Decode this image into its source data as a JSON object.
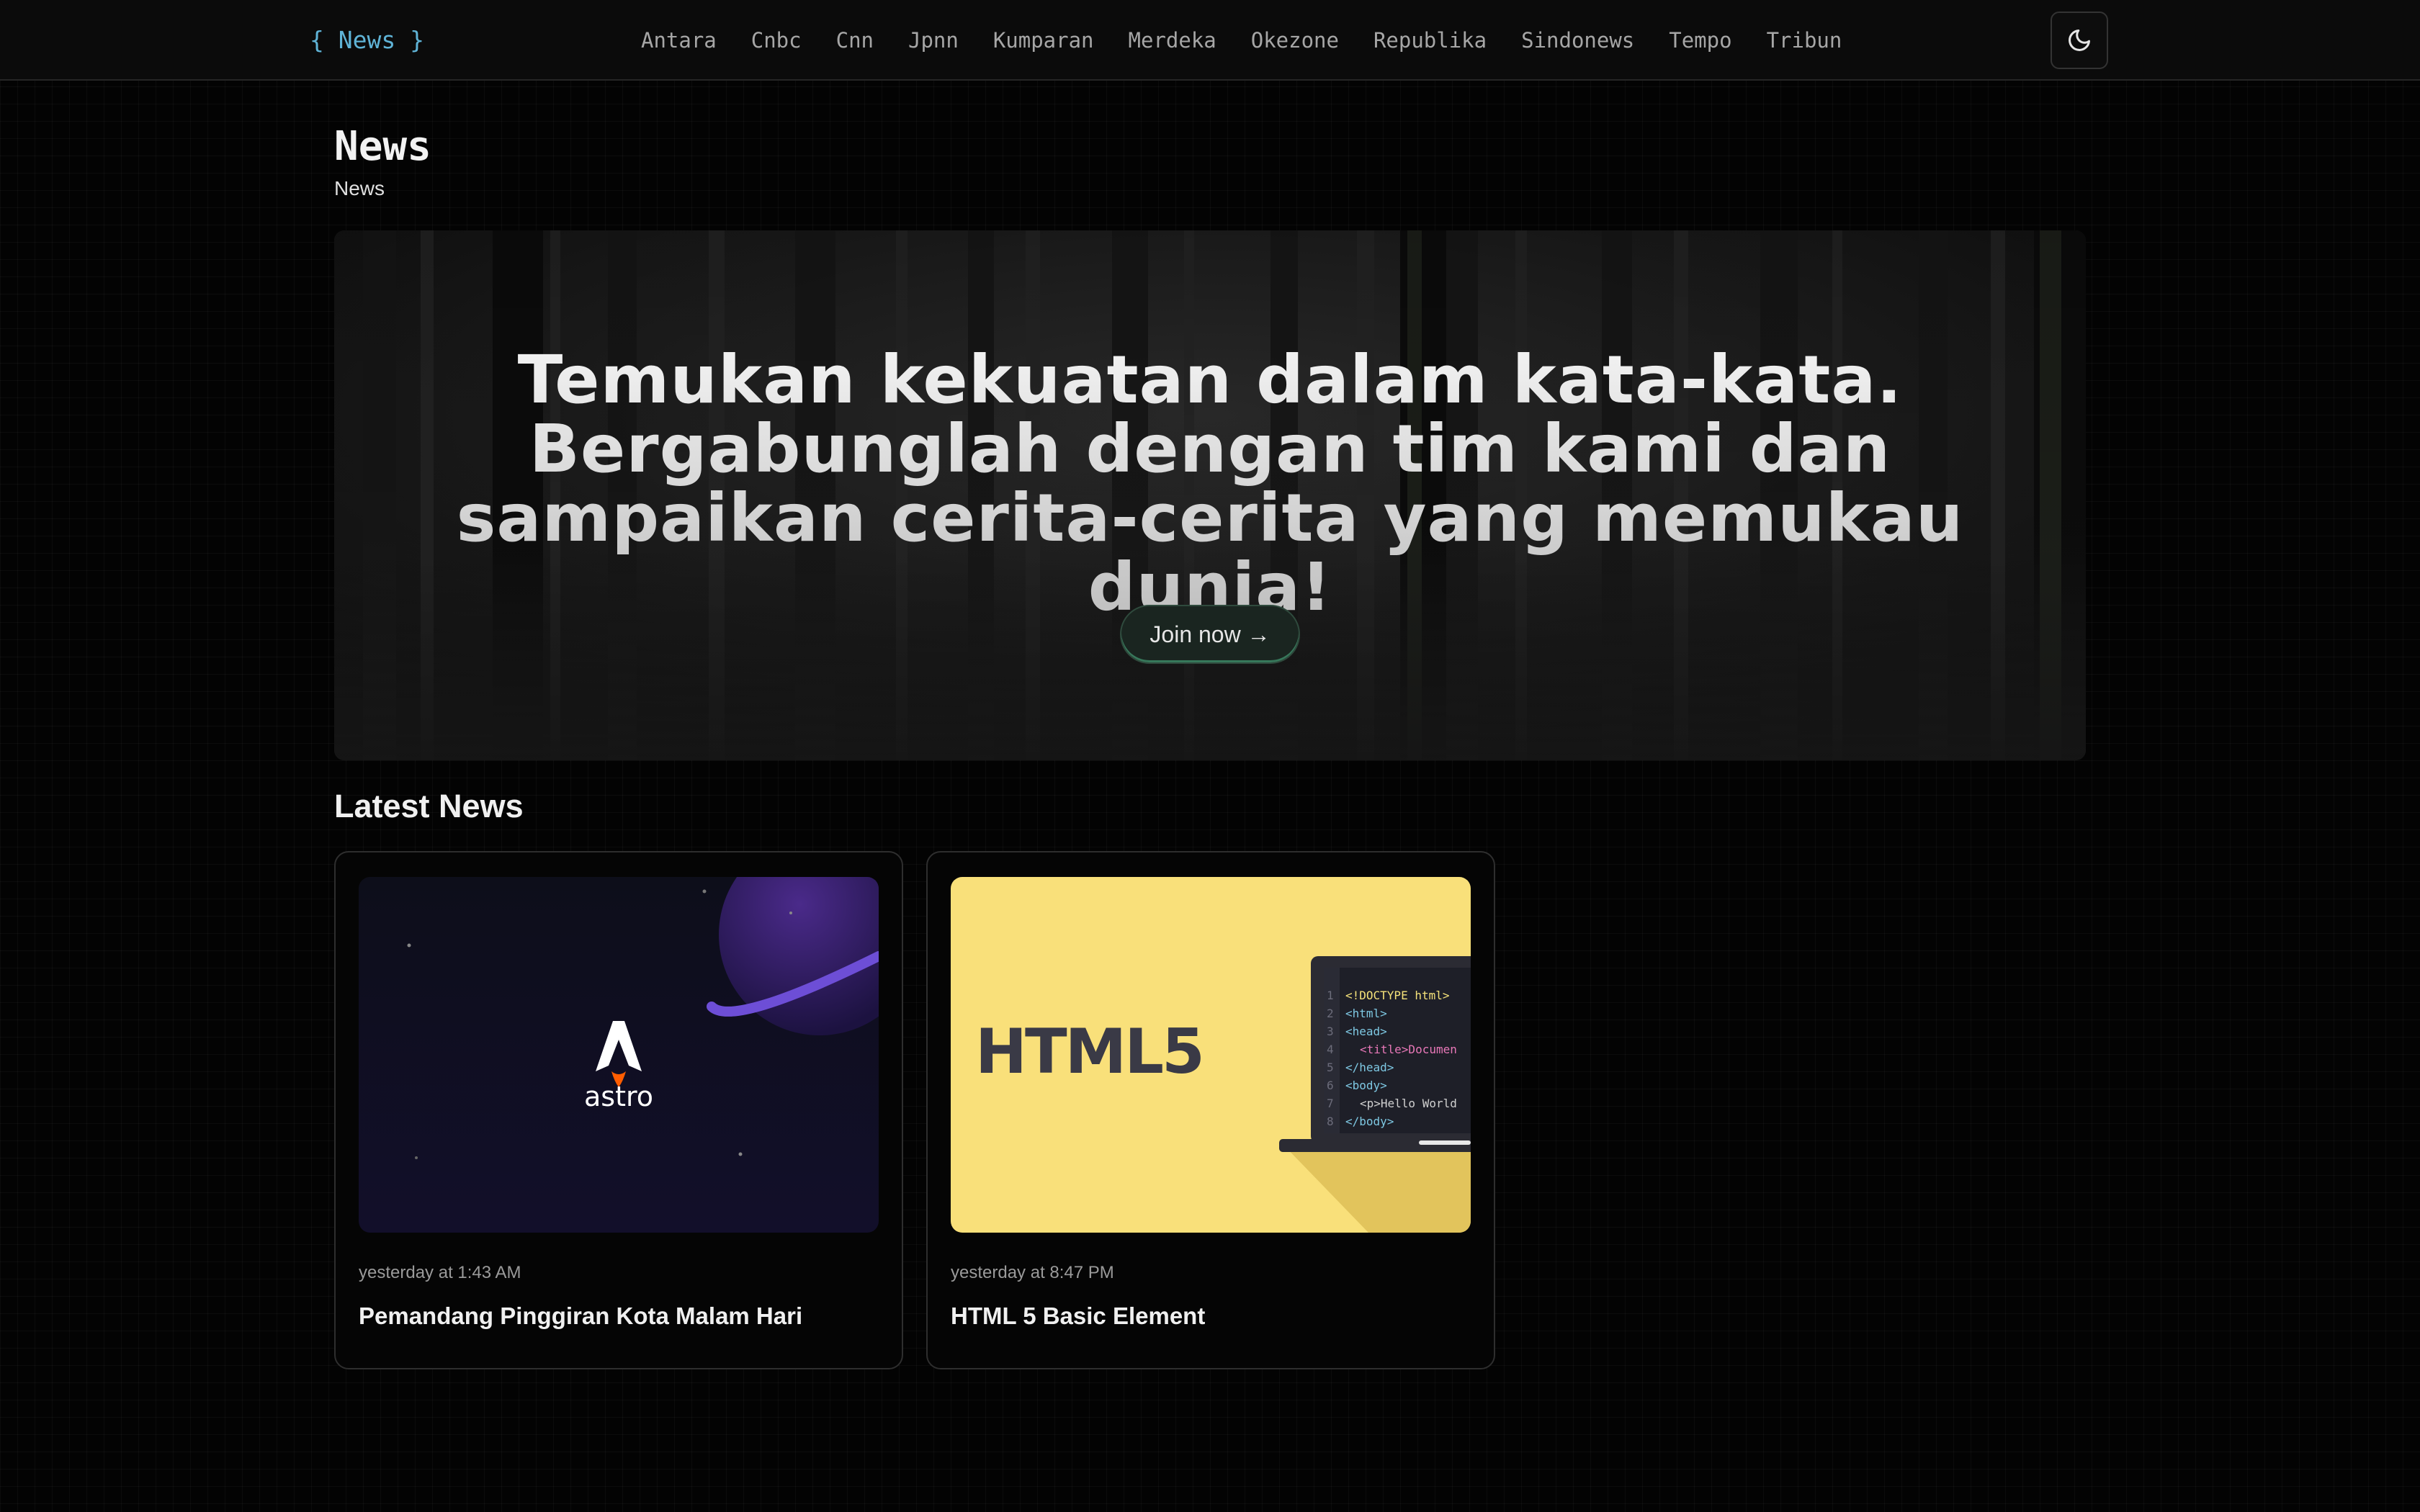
{
  "header": {
    "logo": "{ News }",
    "nav": [
      "Antara",
      "Cnbc",
      "Cnn",
      "Jpnn",
      "Kumparan",
      "Merdeka",
      "Okezone",
      "Republika",
      "Sindonews",
      "Tempo",
      "Tribun"
    ],
    "theme_toggle_icon": "moon-icon"
  },
  "page": {
    "title": "News",
    "subtitle": "News"
  },
  "hero": {
    "heading": "Temukan kekuatan dalam kata-kata. Bergabunglah dengan tim kami dan sampaikan cerita-cerita yang memukau dunia!",
    "cta_label": "Join now →"
  },
  "latest": {
    "title": "Latest News",
    "cards": [
      {
        "date": "yesterday at 1:43 AM",
        "title": "Pemandang Pinggiran Kota Malam Hari",
        "image_wordmark": "astro"
      },
      {
        "date": "yesterday at 8:47 PM",
        "title": "HTML 5 Basic Element",
        "image_wordmark": "HTML5",
        "code_lines": [
          "<!DOCTYPE html>",
          "<html>",
          "<head>",
          "<title>Documen",
          "</head>",
          "<body>",
          "<p>Hello World",
          "</body>"
        ],
        "line_numbers": [
          "1",
          "2",
          "3",
          "4",
          "5",
          "6",
          "7",
          "8"
        ]
      }
    ]
  },
  "colors": {
    "logo": "#5fb3d6",
    "background": "#030303",
    "html5_yellow": "#f9e07a",
    "astro_orange": "#ff5d01"
  }
}
